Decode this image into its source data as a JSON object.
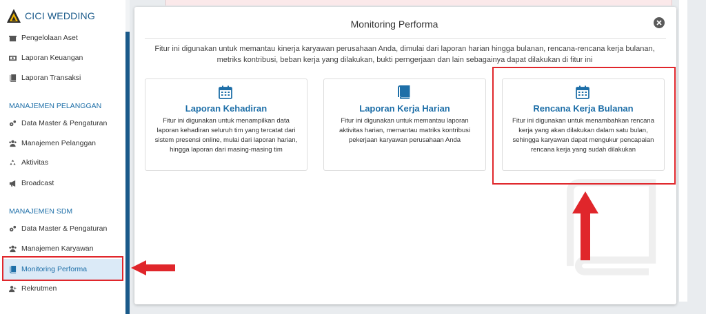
{
  "brand": {
    "name": "CICI WEDDING"
  },
  "sidebar": {
    "items_top": [
      {
        "label": "Pengelolaan Aset",
        "icon": "box-icon"
      },
      {
        "label": "Laporan Keuangan",
        "icon": "money-icon"
      },
      {
        "label": "Laporan Transaksi",
        "icon": "book-icon"
      }
    ],
    "section_pelanggan": "MANAJEMEN PELANGGAN",
    "items_pelanggan": [
      {
        "label": "Data Master & Pengaturan",
        "icon": "gears-icon"
      },
      {
        "label": "Manajemen Pelanggan",
        "icon": "users-icon"
      },
      {
        "label": "Aktivitas",
        "icon": "recycle-icon"
      },
      {
        "label": "Broadcast",
        "icon": "bullhorn-icon"
      }
    ],
    "section_sdm": "MANAJEMEN SDM",
    "items_sdm": [
      {
        "label": "Data Master & Pengaturan",
        "icon": "gears-icon"
      },
      {
        "label": "Manajemen Karyawan",
        "icon": "users-icon"
      },
      {
        "label": "Monitoring Performa",
        "icon": "book-icon",
        "active": true
      },
      {
        "label": "Rekrutmen",
        "icon": "user-plus-icon"
      }
    ]
  },
  "modal": {
    "title": "Monitoring Performa",
    "description": "Fitur ini digunakan untuk memantau kinerja karyawan perusahaan Anda, dimulai dari laporan harian hingga bulanan, rencana-rencana kerja bulanan, metriks kontribusi, beban kerja yang dilakukan, bukti perngerjaan dan lain sebagainya dapat dilakukan di fitur ini",
    "cards": [
      {
        "title": "Laporan Kehadiran",
        "icon": "calendar-icon",
        "description": "Fitur ini digunakan untuk menampilkan data laporan kehadiran seluruh tim yang tercatat dari sistem presensi online, mulai dari laporan harian, hingga laporan dari masing-masing tim"
      },
      {
        "title": "Laporan Kerja Harian",
        "icon": "book-icon",
        "description": "Fitur ini digunakan untuk memantau laporan aktivitas harian, memantau matriks kontribusi pekerjaan karyawan perusahaan Anda"
      },
      {
        "title": "Rencana Kerja Bulanan",
        "icon": "calendar-icon",
        "description": "Fitur ini digunakan untuk menambahkan rencana kerja yang akan dilakukan dalam satu bulan, sehingga karyawan dapat mengukur pencapaian rencana kerja yang sudah dilakukan"
      }
    ]
  },
  "colors": {
    "accent": "#1e6fa8",
    "annotation": "#e0262b"
  }
}
